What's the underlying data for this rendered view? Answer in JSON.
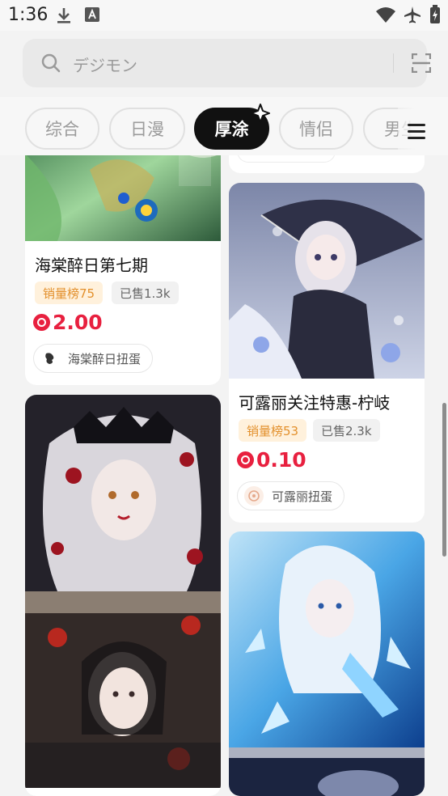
{
  "status_bar": {
    "time": "1:36"
  },
  "search": {
    "placeholder": "デジモン"
  },
  "tabs": [
    {
      "label": "综合",
      "active": false
    },
    {
      "label": "日漫",
      "active": false
    },
    {
      "label": "厚涂",
      "active": true
    },
    {
      "label": "情侣",
      "active": false
    },
    {
      "label": "男生",
      "active": false
    }
  ],
  "feed": {
    "left": [
      {
        "title": "海棠醉日第七期",
        "rank": "销量榜75",
        "sold": "已售1.3k",
        "price": "2.00",
        "shop": "海棠醉日扭蛋"
      }
    ],
    "right": [
      {
        "title": "可露丽关注特惠-柠岐",
        "rank": "销量榜53",
        "sold": "已售2.3k",
        "price": "0.10",
        "shop": "可露丽扭蛋"
      }
    ]
  },
  "colors": {
    "accent": "#e8203f",
    "rank_text": "#e3902c",
    "rank_bg": "#fff1dc",
    "active_tab": "#111111"
  }
}
